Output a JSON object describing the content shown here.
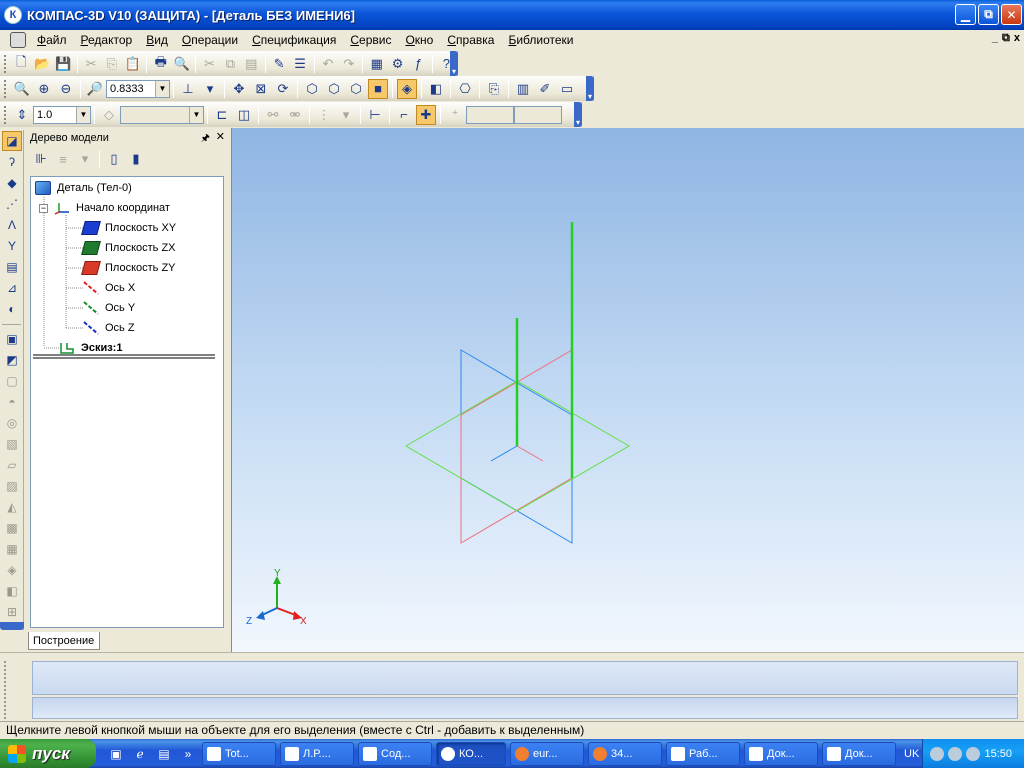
{
  "window": {
    "title": "КОМПАС-3D V10 (ЗАЩИТА) - [Деталь БЕЗ ИМЕНИ6]",
    "app_icon": "К",
    "controls": [
      "minimize-icon",
      "restore-icon",
      "close-icon"
    ]
  },
  "menu": {
    "items": [
      "Файл",
      "Редактор",
      "Вид",
      "Операции",
      "Спецификация",
      "Сервис",
      "Окно",
      "Справка",
      "Библиотеки"
    ],
    "mdi_controls": [
      "_",
      "⧉",
      "x"
    ]
  },
  "toolbar_view": {
    "zoom_value": "0.8333"
  },
  "toolbar_sketch": {
    "step_value": "1.0"
  },
  "tree": {
    "header": "Дерево модели",
    "items": [
      {
        "label": "Деталь (Тел-0)",
        "icon": "part-icon"
      },
      {
        "label": "Начало координат",
        "icon": "origin-icon",
        "expander": "−"
      },
      {
        "label": "Плоскость XY",
        "icon": "plane-xy-icon"
      },
      {
        "label": "Плоскость ZX",
        "icon": "plane-zx-icon"
      },
      {
        "label": "Плоскость ZY",
        "icon": "plane-zy-icon"
      },
      {
        "label": "Ось X",
        "icon": "axis-x-icon"
      },
      {
        "label": "Ось Y",
        "icon": "axis-y-icon"
      },
      {
        "label": "Ось Z",
        "icon": "axis-z-icon"
      },
      {
        "label": "Эскиз:1",
        "icon": "sketch-icon"
      }
    ],
    "tab_label": "Построение"
  },
  "viewport": {
    "triad": {
      "x": "X",
      "y": "Y",
      "z": "Z"
    },
    "colors": {
      "plane_xy": "#1a7ff0",
      "plane_zx": "#55e040",
      "plane_zy": "#f06070",
      "sketch": "#1ed01e"
    }
  },
  "status": {
    "text": "Щелкните левой кнопкой мыши на объекте для его выделения (вместе с Ctrl - добавить к выделенным)"
  },
  "taskbar": {
    "start_label": "пуск",
    "buttons": [
      "Tot...",
      "Л.Р....",
      "Сод...",
      "КО...",
      "eur...",
      "34...",
      "Раб...",
      "Док...",
      "Док..."
    ],
    "active_index": 3,
    "language": "UK",
    "clock": "15:50"
  }
}
